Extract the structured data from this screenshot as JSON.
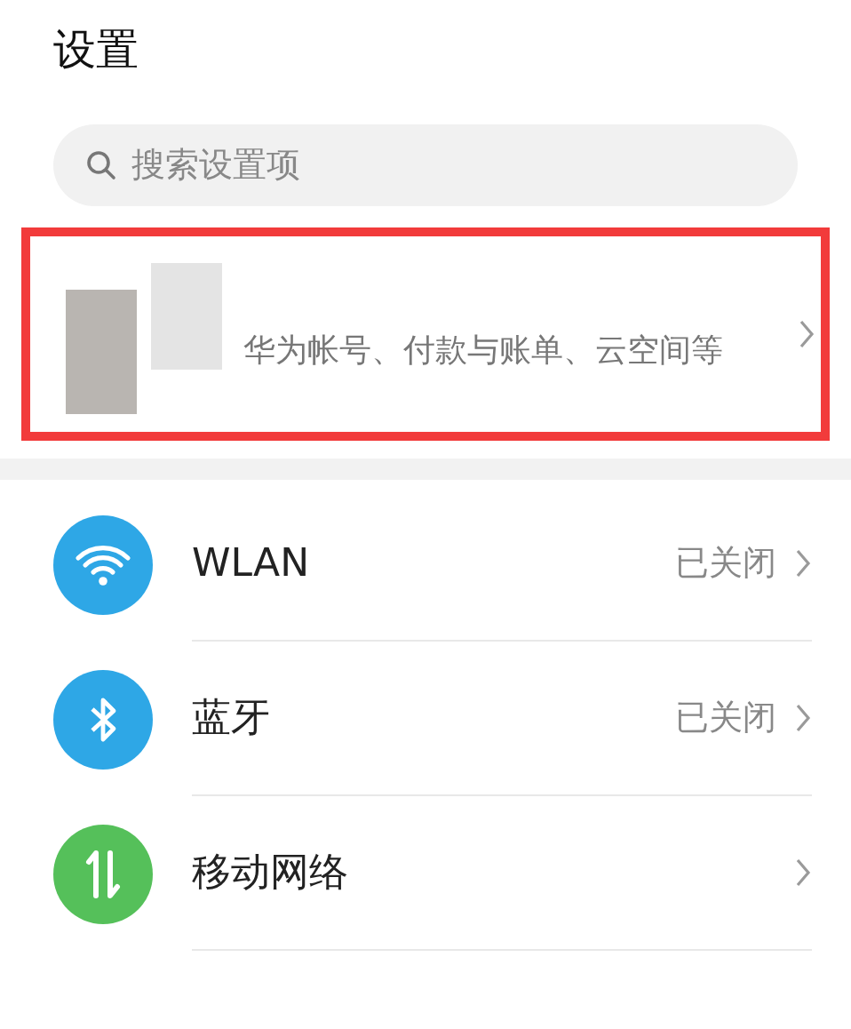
{
  "title": "设置",
  "search": {
    "placeholder": "搜索设置项"
  },
  "account": {
    "summary": "华为帐号、付款与账单、云空间等",
    "highlighted": true
  },
  "items": [
    {
      "kind": "wifi",
      "label": "WLAN",
      "status": "已关闭",
      "color": "#2ea7e6"
    },
    {
      "kind": "bluetooth",
      "label": "蓝牙",
      "status": "已关闭",
      "color": "#2ea7e6"
    },
    {
      "kind": "mobile",
      "label": "移动网络",
      "color": "#55c05a"
    }
  ]
}
